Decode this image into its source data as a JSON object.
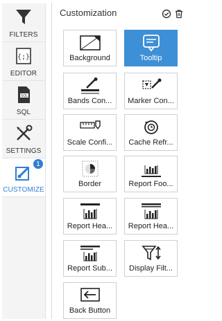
{
  "sidebar": {
    "items": [
      {
        "label": "FILTERS"
      },
      {
        "label": "EDITOR"
      },
      {
        "label": "SQL"
      },
      {
        "label": "SETTINGS"
      },
      {
        "label": "CUSTOMIZE",
        "badge": "1"
      }
    ]
  },
  "panel": {
    "title": "Customization"
  },
  "tiles": [
    {
      "label": "Background"
    },
    {
      "label": "Tooltip"
    },
    {
      "label": "Bands Con..."
    },
    {
      "label": "Marker Con..."
    },
    {
      "label": "Scale Confi..."
    },
    {
      "label": "Cache Refr..."
    },
    {
      "label": "Border"
    },
    {
      "label": "Report Foo..."
    },
    {
      "label": "Report Hea..."
    },
    {
      "label": "Report Hea..."
    },
    {
      "label": "Report Sub..."
    },
    {
      "label": "Display Filt..."
    },
    {
      "label": "Back Button"
    }
  ],
  "colors": {
    "accent": "#2f7fd1",
    "active_tile": "#3d8fd6"
  }
}
